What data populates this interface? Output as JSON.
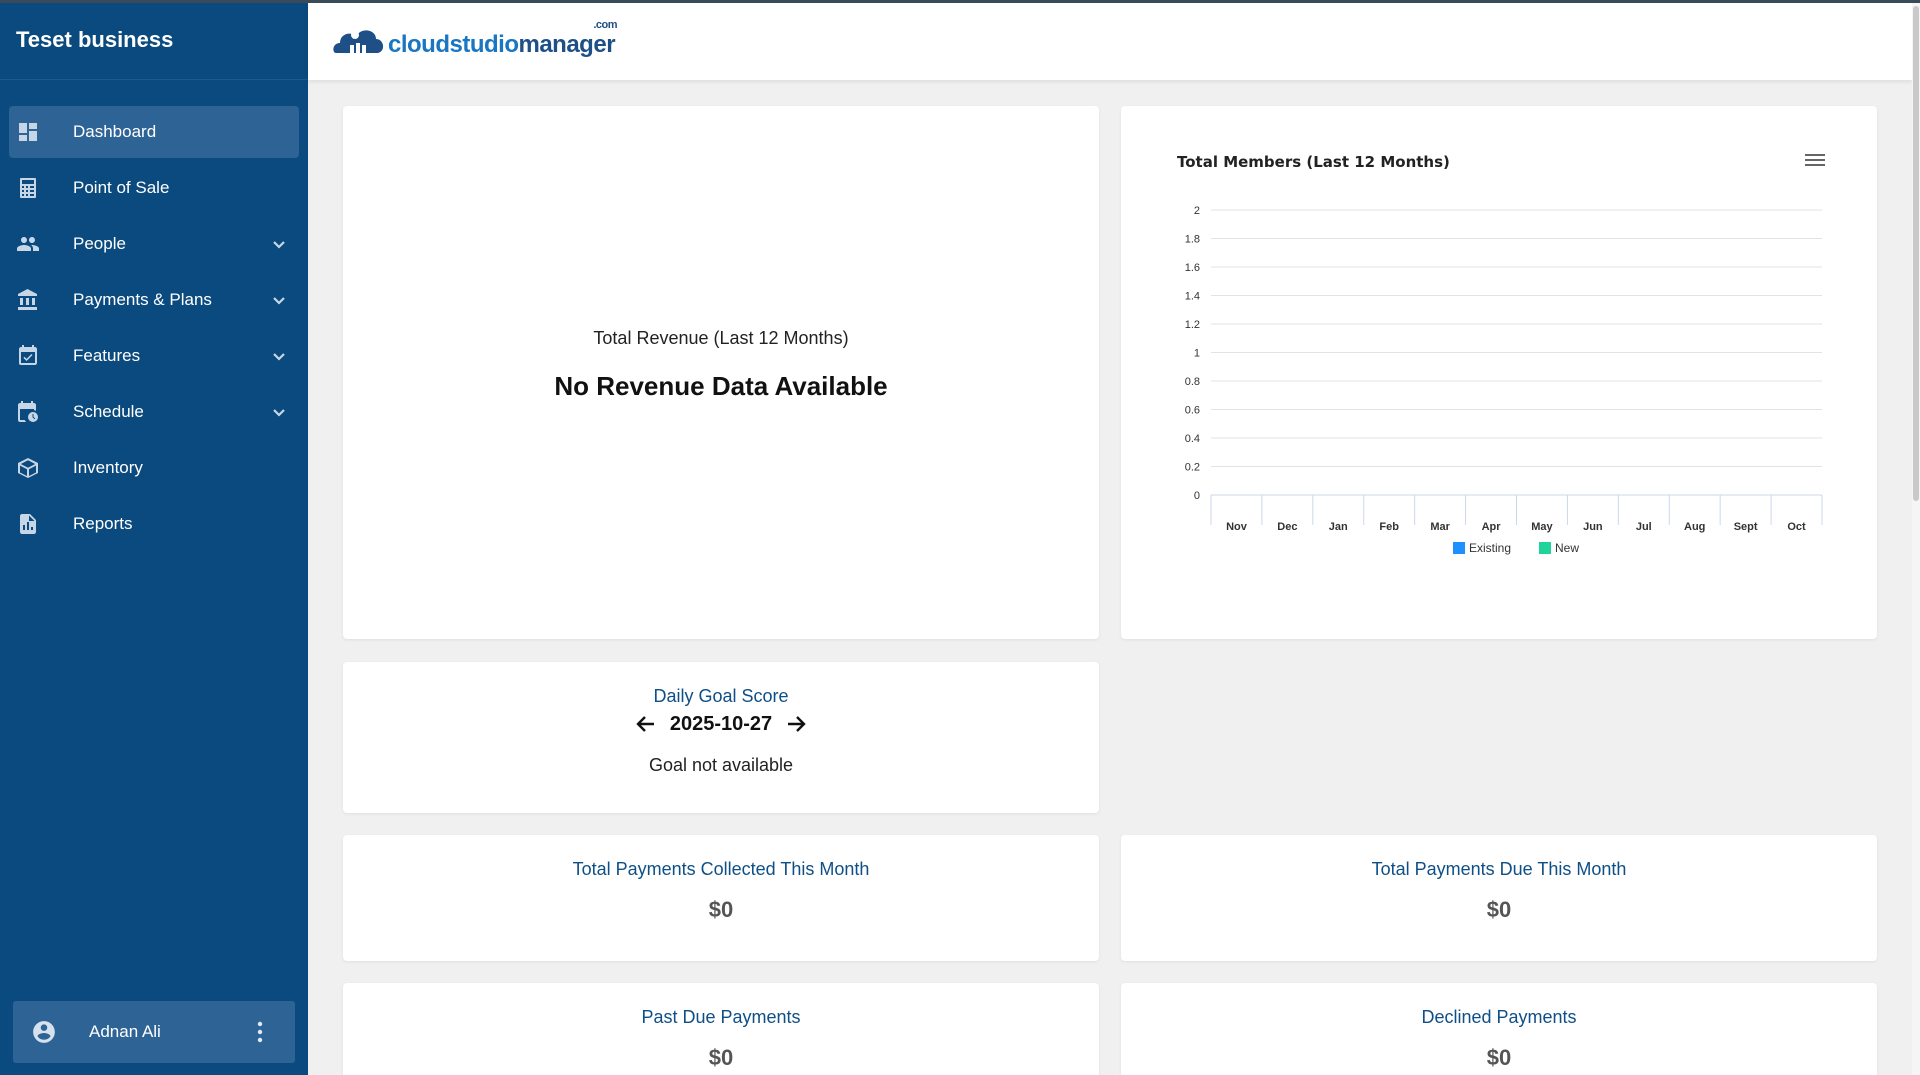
{
  "sidebar": {
    "business_name": "Teset business",
    "items": [
      {
        "label": "Dashboard"
      },
      {
        "label": "Point of Sale"
      },
      {
        "label": "People"
      },
      {
        "label": "Payments & Plans"
      },
      {
        "label": "Features"
      },
      {
        "label": "Schedule"
      },
      {
        "label": "Inventory"
      },
      {
        "label": "Reports"
      }
    ],
    "user": {
      "name": "Adnan Ali"
    }
  },
  "header": {
    "logo_part1": "cloudstudio",
    "logo_part2": "manager",
    "logo_suffix": ".com"
  },
  "revenue_card": {
    "title": "Total Revenue (Last 12 Months)",
    "message": "No Revenue Data Available"
  },
  "members_card": {
    "title": "Total Members (Last 12 Months)"
  },
  "chart_data": {
    "type": "bar",
    "title": "Total Members (Last 12 Months)",
    "categories": [
      "Nov",
      "Dec",
      "Jan",
      "Feb",
      "Mar",
      "Apr",
      "May",
      "Jun",
      "Jul",
      "Aug",
      "Sept",
      "Oct"
    ],
    "series": [
      {
        "name": "Existing",
        "values": [
          0,
          0,
          0,
          0,
          0,
          0,
          0,
          0,
          0,
          0,
          0,
          0
        ],
        "color": "#1e90ff"
      },
      {
        "name": "New",
        "values": [
          0,
          0,
          0,
          0,
          0,
          0,
          0,
          0,
          0,
          0,
          0,
          0
        ],
        "color": "#1fd39a"
      }
    ],
    "yticks": [
      "0",
      "0.2",
      "0.4",
      "0.6",
      "0.8",
      "1",
      "1.2",
      "1.4",
      "1.6",
      "1.8",
      "2"
    ],
    "ylim": [
      0,
      2
    ],
    "grid": true,
    "legend": "bottom",
    "xlabel": "",
    "ylabel": ""
  },
  "goal_card": {
    "title": "Daily Goal Score",
    "date": "2025-10-27",
    "message": "Goal not available"
  },
  "stats": {
    "collected": {
      "label": "Total Payments Collected This Month",
      "value": "$0"
    },
    "due": {
      "label": "Total Payments Due This Month",
      "value": "$0"
    },
    "past_due": {
      "label": "Past Due Payments",
      "value": "$0"
    },
    "declined": {
      "label": "Declined Payments",
      "value": "$0"
    }
  }
}
